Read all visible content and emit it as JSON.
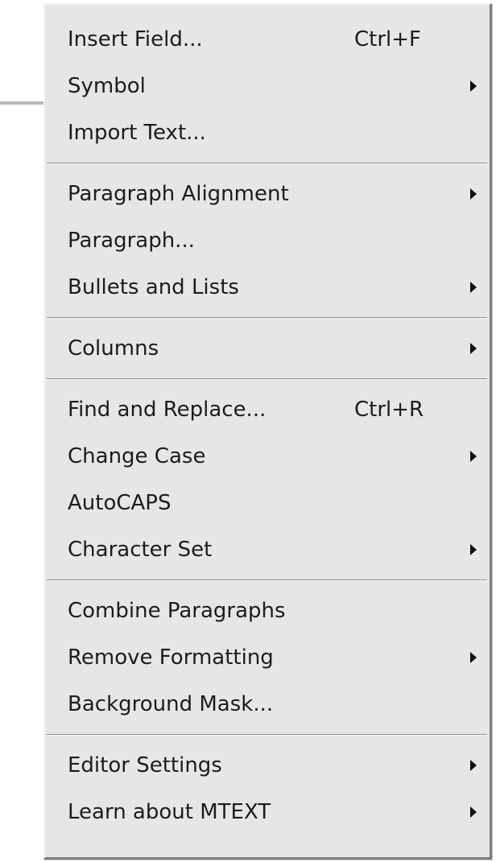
{
  "menu": {
    "groups": [
      [
        {
          "label": "Insert Field...",
          "shortcut": "Ctrl+F",
          "submenu": false
        },
        {
          "label": "Symbol",
          "shortcut": "",
          "submenu": true
        },
        {
          "label": "Import Text...",
          "shortcut": "",
          "submenu": false
        }
      ],
      [
        {
          "label": "Paragraph Alignment",
          "shortcut": "",
          "submenu": true
        },
        {
          "label": "Paragraph...",
          "shortcut": "",
          "submenu": false
        },
        {
          "label": "Bullets and Lists",
          "shortcut": "",
          "submenu": true
        }
      ],
      [
        {
          "label": "Columns",
          "shortcut": "",
          "submenu": true
        }
      ],
      [
        {
          "label": "Find and Replace...",
          "shortcut": "Ctrl+R",
          "submenu": false
        },
        {
          "label": "Change Case",
          "shortcut": "",
          "submenu": true
        },
        {
          "label": "AutoCAPS",
          "shortcut": "",
          "submenu": false
        },
        {
          "label": "Character Set",
          "shortcut": "",
          "submenu": true
        }
      ],
      [
        {
          "label": "Combine Paragraphs",
          "shortcut": "",
          "submenu": false
        },
        {
          "label": "Remove Formatting",
          "shortcut": "",
          "submenu": true
        },
        {
          "label": "Background Mask...",
          "shortcut": "",
          "submenu": false
        }
      ],
      [
        {
          "label": "Editor Settings",
          "shortcut": "",
          "submenu": true
        },
        {
          "label": "Learn about MTEXT",
          "shortcut": "",
          "submenu": true
        }
      ]
    ],
    "colors": {
      "background": "#e6e6e6",
      "text": "#1c1c1c",
      "separator_dark": "#8e8e8e",
      "separator_light": "#fafafa"
    },
    "submenu_icon": "submenu-arrow-icon"
  }
}
